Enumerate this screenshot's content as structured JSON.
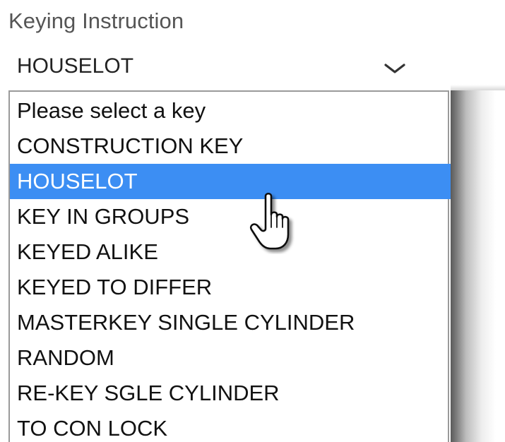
{
  "field": {
    "label": "Keying Instruction",
    "selected_value": "HOUSELOT",
    "chevron_icon": "chevron-down-icon"
  },
  "dropdown": {
    "options": [
      "Please select a key",
      "CONSTRUCTION KEY",
      "HOUSELOT",
      "KEY IN GROUPS",
      "KEYED ALIKE",
      "KEYED TO DIFFER",
      "MASTERKEY SINGLE CYLINDER",
      "RANDOM",
      "RE-KEY SGLE CYLINDER",
      "TO CON LOCK"
    ],
    "highlighted_option": "HOUSELOT",
    "highlight_color": "#3c8ef3"
  },
  "cursor": {
    "icon": "hand-pointer-icon"
  }
}
